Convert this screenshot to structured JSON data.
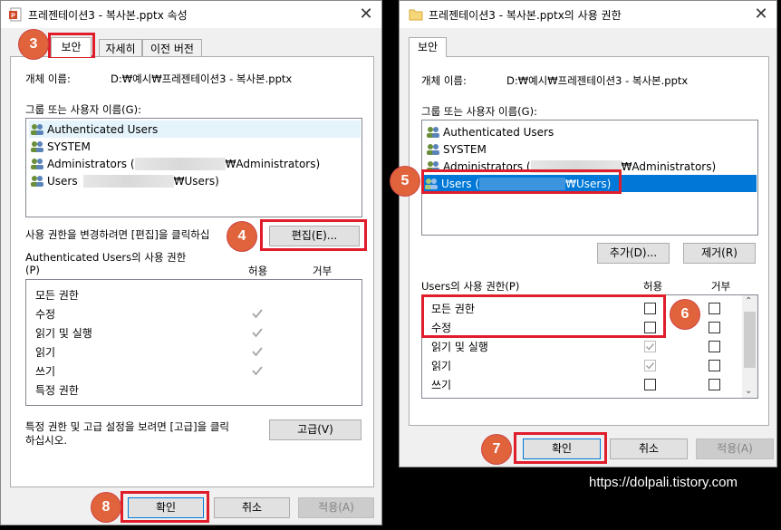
{
  "left_window": {
    "title": "프레젠테이션3 - 복사본.pptx 속성",
    "tabs": [
      {
        "label": "보안"
      },
      {
        "label": "자세히"
      },
      {
        "label": "이전 버전"
      }
    ],
    "object_label": "개체 이름:",
    "object_value": "D:₩예시₩프레젠테이션3 - 복사본.pptx",
    "group_label": "그룹 또는 사용자 이름(G):",
    "users": [
      {
        "name": "Authenticated Users"
      },
      {
        "name": "SYSTEM"
      },
      {
        "name_prefix": "Administrators (",
        "name_suffix": "₩Administrators)"
      },
      {
        "name_prefix": "Users",
        "name_suffix": "₩Users)"
      }
    ],
    "edit_hint": "사용 권한을 변경하려면 [편집]을 클릭하십",
    "edit_button": "편집(E)...",
    "perm_title_line1": "Authenticated Users의 사용 권한",
    "perm_title_line2": "(P)",
    "allow_header": "허용",
    "deny_header": "거부",
    "permissions": [
      {
        "name": "모든 권한",
        "allow": false
      },
      {
        "name": "수정",
        "allow": true
      },
      {
        "name": "읽기 및 실행",
        "allow": true
      },
      {
        "name": "읽기",
        "allow": true
      },
      {
        "name": "쓰기",
        "allow": true
      },
      {
        "name": "특정 권한",
        "allow": false
      }
    ],
    "advanced_hint_line1": "특정 권한 및 고급 설정을 보려면 [고급]을 클릭",
    "advanced_hint_line2": "하십시오.",
    "advanced_button": "고급(V)",
    "ok_button": "확인",
    "cancel_button": "취소",
    "apply_button": "적용(A)"
  },
  "right_window": {
    "title": "프레젠테이션3 - 복사본.pptx의 사용 권한",
    "tab": "보안",
    "object_label": "개체 이름:",
    "object_value": "D:₩예시₩프레젠테이션3 - 복사본.pptx",
    "group_label": "그룹 또는 사용자 이름(G):",
    "users": [
      {
        "name": "Authenticated Users"
      },
      {
        "name": "SYSTEM"
      },
      {
        "name_prefix": "Administrators (",
        "name_suffix": "₩Administrators)"
      },
      {
        "name_prefix": "Users (",
        "name_suffix": "₩Users)"
      }
    ],
    "add_button": "추가(D)...",
    "remove_button": "제거(R)",
    "perm_title": "Users의 사용 권한(P)",
    "allow_header": "허용",
    "deny_header": "거부",
    "permissions": [
      {
        "name": "모든 권한",
        "allow": false,
        "allow_disabled": false,
        "deny": false
      },
      {
        "name": "수정",
        "allow": false,
        "allow_disabled": false,
        "deny": false
      },
      {
        "name": "읽기 및 실행",
        "allow": true,
        "allow_disabled": true,
        "deny": false
      },
      {
        "name": "읽기",
        "allow": true,
        "allow_disabled": true,
        "deny": false
      },
      {
        "name": "쓰기",
        "allow": false,
        "allow_disabled": false,
        "deny": false
      }
    ],
    "ok_button": "확인",
    "cancel_button": "취소",
    "apply_button": "적용(A)"
  },
  "badges": {
    "b3": "3",
    "b4": "4",
    "b5": "5",
    "b6": "6",
    "b7": "7",
    "b8": "8"
  },
  "watermark": "https://dolpali.tistory.com",
  "colors": {
    "highlight": "#e01d2b",
    "badge": "#e0633c",
    "selection": "#0078d7"
  }
}
